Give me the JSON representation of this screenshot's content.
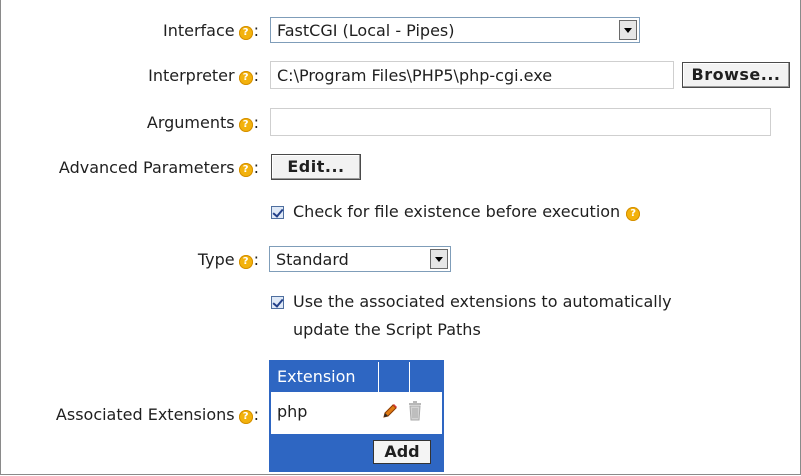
{
  "interface": {
    "label": "Interface",
    "value": "FastCGI (Local - Pipes)"
  },
  "interpreter": {
    "label": "Interpreter",
    "value": "C:\\Program Files\\PHP5\\php-cgi.exe",
    "browse_label": "Browse..."
  },
  "arguments": {
    "label": "Arguments",
    "value": ""
  },
  "advanced": {
    "label": "Advanced Parameters",
    "edit_label": "Edit..."
  },
  "check_existence": {
    "label": "Check for file existence before execution",
    "checked": true
  },
  "type": {
    "label": "Type",
    "value": "Standard"
  },
  "use_extensions": {
    "label_line1": "Use the associated extensions to automatically",
    "label_line2": "update the Script Paths",
    "checked": true
  },
  "associated_extensions": {
    "label": "Associated Extensions",
    "header": "Extension",
    "rows": [
      {
        "name": "php"
      }
    ],
    "add_label": "Add"
  },
  "help_glyph": "?",
  "colon": ":",
  "icons": [
    "help-icon",
    "pencil-icon",
    "trash-icon",
    "chevron-down-icon"
  ],
  "colors": {
    "table_header": "#2e66c2",
    "help_badge": "#f3b20c"
  }
}
